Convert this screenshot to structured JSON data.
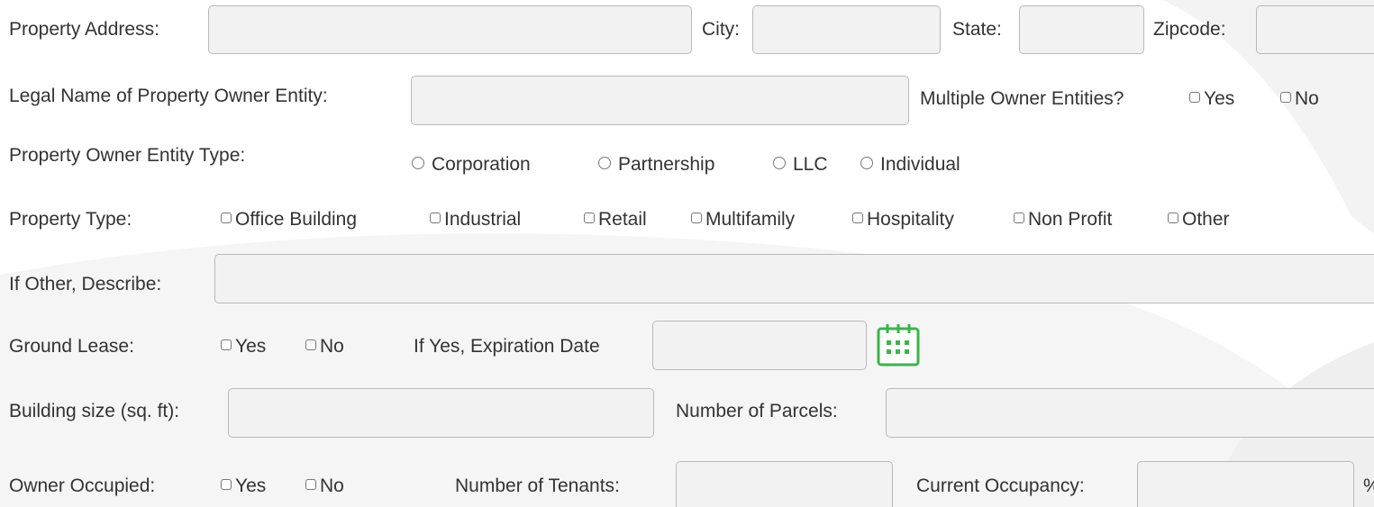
{
  "form": {
    "row1": {
      "address_label": "Property Address:",
      "address_value": "",
      "city_label": "City:",
      "city_value": "",
      "state_label": "State:",
      "state_value": "",
      "zip_label": "Zipcode:",
      "zip_value": ""
    },
    "row2": {
      "owner_label": "Legal Name of Property Owner Entity:",
      "owner_value": "",
      "multiple_label": "Multiple Owner Entities?",
      "yes": "Yes",
      "no": "No"
    },
    "row3": {
      "label": "Property Owner Entity Type:",
      "options": [
        "Corporation",
        "Partnership",
        "LLC",
        "Individual"
      ]
    },
    "row4": {
      "label": "Property Type:",
      "options": [
        "Office Building",
        "Industrial",
        "Retail",
        "Multifamily",
        "Hospitality",
        "Non Profit",
        "Other"
      ]
    },
    "row5": {
      "label": "If Other, Describe:",
      "value": ""
    },
    "row6": {
      "label": "Ground Lease:",
      "yes": "Yes",
      "no": "No",
      "expiration_label": "If Yes, Expiration Date",
      "expiration_value": "",
      "icon": "calendar-icon",
      "accent_color": "#39b54a"
    },
    "row7": {
      "size_label": "Building size (sq. ft):",
      "size_value": "",
      "parcels_label": "Number of Parcels:",
      "parcels_value": ""
    },
    "row8": {
      "label": "Owner Occupied:",
      "yes": "Yes",
      "no": "No",
      "tenants_label": "Number of Tenants:",
      "tenants_value": "",
      "occupancy_label": "Current Occupancy:",
      "occupancy_value": "",
      "percent": "%"
    }
  }
}
